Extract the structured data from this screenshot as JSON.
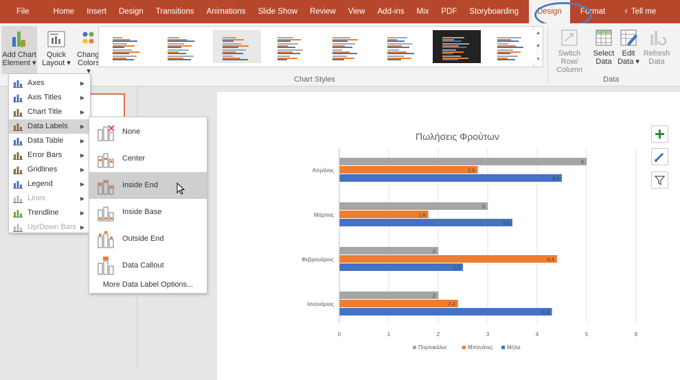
{
  "tabs": [
    "File",
    "Home",
    "Insert",
    "Design",
    "Transitions",
    "Animations",
    "Slide Show",
    "Review",
    "View",
    "Add-ins",
    "Mix",
    "PDF",
    "Storyboarding",
    "Design",
    "Format",
    "Tell me"
  ],
  "active_tab_index": 13,
  "ribbon": {
    "add_chart_element": [
      "Add Chart",
      "Element ▾"
    ],
    "quick_layout": [
      "Quick",
      "Layout ▾"
    ],
    "change_colors": [
      "Change",
      "Colors ▾"
    ],
    "chart_styles_label": "Chart Styles",
    "switch_row_column": [
      "Switch Row/",
      "Column"
    ],
    "select_data": [
      "Select",
      "Data"
    ],
    "edit_data": [
      "Edit",
      "Data ▾"
    ],
    "refresh_data": [
      "Refresh",
      "Data"
    ],
    "data_group_label": "Data"
  },
  "add_chart_menu": [
    {
      "label": "Axes",
      "icon": "axes-icon",
      "arrow": true,
      "disabled": false,
      "highlighted": false
    },
    {
      "label": "Axis Titles",
      "icon": "axis-titles-icon",
      "arrow": true,
      "disabled": false,
      "highlighted": false
    },
    {
      "label": "Chart Title",
      "icon": "chart-title-icon",
      "arrow": true,
      "disabled": false,
      "highlighted": false
    },
    {
      "label": "Data Labels",
      "icon": "data-labels-icon",
      "arrow": true,
      "disabled": false,
      "highlighted": true
    },
    {
      "label": "Data Table",
      "icon": "data-table-icon",
      "arrow": true,
      "disabled": false,
      "highlighted": false
    },
    {
      "label": "Error Bars",
      "icon": "error-bars-icon",
      "arrow": true,
      "disabled": false,
      "highlighted": false
    },
    {
      "label": "Gridlines",
      "icon": "gridlines-icon",
      "arrow": true,
      "disabled": false,
      "highlighted": false
    },
    {
      "label": "Legend",
      "icon": "legend-icon",
      "arrow": true,
      "disabled": false,
      "highlighted": false
    },
    {
      "label": "Lines",
      "icon": "lines-icon",
      "arrow": true,
      "disabled": true,
      "highlighted": false
    },
    {
      "label": "Trendline",
      "icon": "trendline-icon",
      "arrow": true,
      "disabled": false,
      "highlighted": false
    },
    {
      "label": "Up/Down Bars",
      "icon": "up-down-bars-icon",
      "arrow": true,
      "disabled": true,
      "highlighted": false
    }
  ],
  "data_labels_submenu": [
    {
      "label": "None",
      "icon": "no-labels-icon",
      "highlighted": false
    },
    {
      "label": "Center",
      "icon": "center-labels-icon",
      "highlighted": false
    },
    {
      "label": "Inside End",
      "icon": "inside-end-labels-icon",
      "highlighted": true
    },
    {
      "label": "Inside Base",
      "icon": "inside-base-labels-icon",
      "highlighted": false
    },
    {
      "label": "Outside End",
      "icon": "outside-end-labels-icon",
      "highlighted": false
    },
    {
      "label": "Data Callout",
      "icon": "data-callout-icon",
      "highlighted": false
    }
  ],
  "more_options": "More Data Label Options...",
  "colors": {
    "accent": "#b7472a",
    "highlight_oval": "#4a7fc1",
    "series_gray": "#a5a5a5",
    "series_orange": "#ed7d31",
    "series_blue": "#4472c4"
  },
  "chart_data": {
    "type": "bar",
    "orientation": "horizontal",
    "title": "Πωλήσεις Φρούτων",
    "categories": [
      "Απρίλιος",
      "Μάρτιος",
      "Φεβρουάριος",
      "Ιανουάριος"
    ],
    "series": [
      {
        "name": "Πορτοκάλια",
        "values": [
          5,
          3,
          2,
          2
        ]
      },
      {
        "name": "Μπανάνες",
        "values": [
          2.8,
          1.8,
          4.4,
          2.4
        ]
      },
      {
        "name": "Μήλα",
        "values": [
          4.5,
          3.5,
          2.5,
          4.3
        ]
      }
    ],
    "value_labels": [
      [
        "5",
        "3",
        "2",
        "2"
      ],
      [
        "2,8",
        "1,8",
        "4,4",
        "2,4"
      ],
      [
        "4,5",
        "3,5",
        "2,5",
        "4,3"
      ]
    ],
    "xlim": [
      0,
      6
    ],
    "x_ticks": [
      "0",
      "1",
      "2",
      "3",
      "4",
      "5",
      "6"
    ],
    "legend_position": "bottom",
    "grid": true
  }
}
